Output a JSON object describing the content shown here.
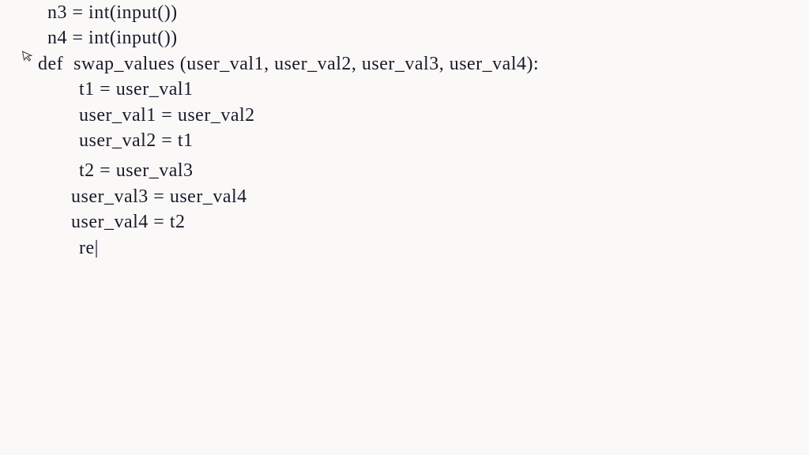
{
  "handwritten_code": {
    "lines": [
      {
        "text": "n3 = int(input())",
        "indent": "indent0",
        "id": "line-n3"
      },
      {
        "text": "n4 = int(input())",
        "indent": "indent0",
        "id": "line-n4"
      },
      {
        "text": "def  swap_values (user_val1, user_val2, user_val3, user_val4):",
        "indent": "indent1",
        "id": "line-def"
      },
      {
        "text": "t1 = user_val1",
        "indent": "indent2",
        "id": "line-t1"
      },
      {
        "text": "user_val1 = user_val2",
        "indent": "indent2",
        "id": "line-uv1"
      },
      {
        "text": "user_val2 = t1",
        "indent": "indent2",
        "id": "line-uv2"
      },
      {
        "text": "t2 = user_val3",
        "indent": "indent2",
        "id": "line-t2"
      },
      {
        "text": "user_val3 = user_val4",
        "indent": "indent3",
        "id": "line-uv3"
      },
      {
        "text": "user_val4 = t2",
        "indent": "indent3",
        "id": "line-uv4"
      },
      {
        "text": "re|",
        "indent": "indent2",
        "id": "line-ret"
      }
    ]
  },
  "cursor_glyph": "↖"
}
